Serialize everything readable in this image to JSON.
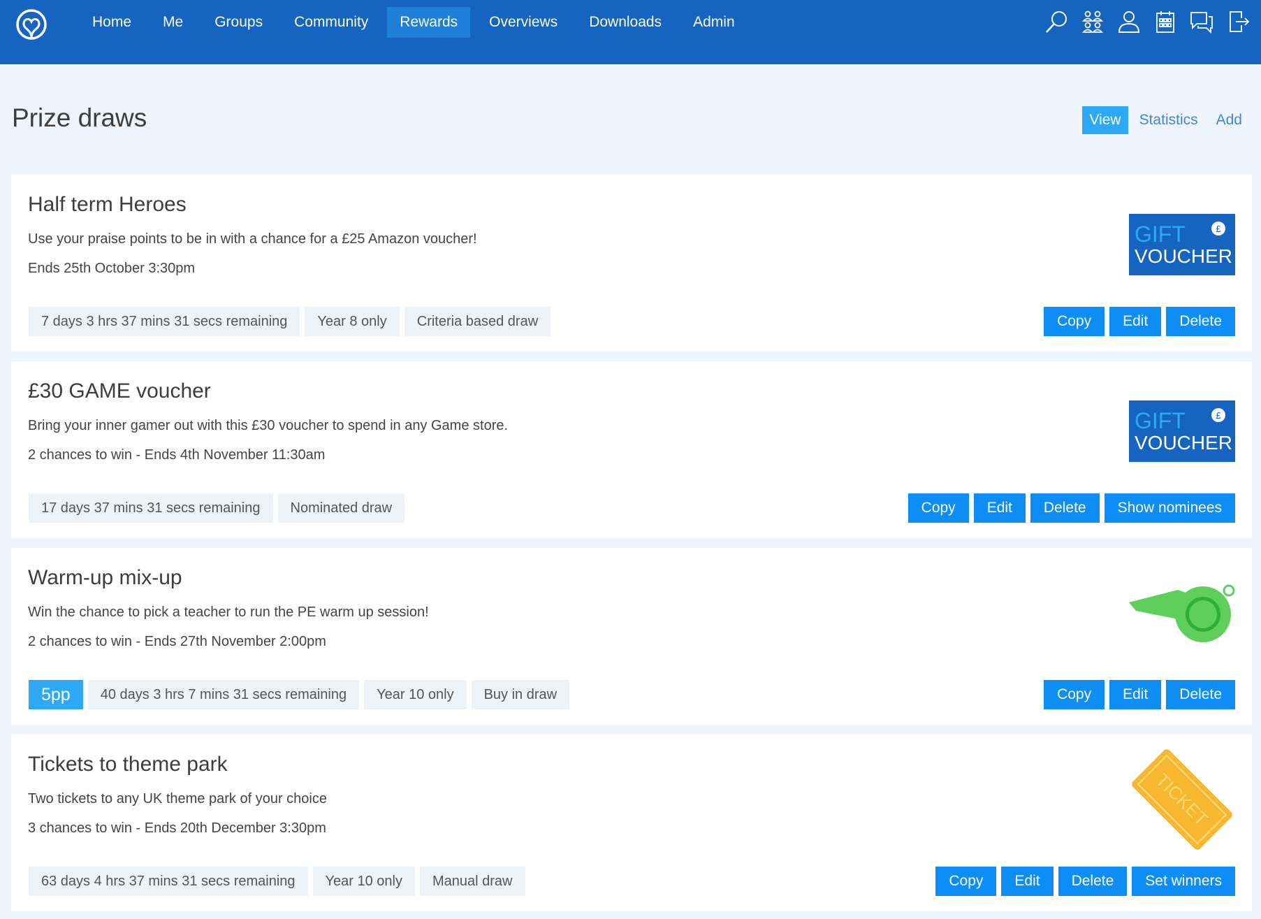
{
  "nav": {
    "logo_icon": "brand-swirl-logo",
    "items": [
      "Home",
      "Me",
      "Groups",
      "Community",
      "Rewards",
      "Overviews",
      "Downloads",
      "Admin"
    ],
    "active_index": 4,
    "icons": [
      "search-icon",
      "groups-icon",
      "user-icon",
      "calendar-icon",
      "messages-icon",
      "logout-icon"
    ]
  },
  "page": {
    "title": "Prize draws",
    "tabs": [
      "View",
      "Statistics",
      "Add"
    ],
    "active_tab": 0
  },
  "draws": [
    {
      "title": "Half term Heroes",
      "description": "Use your praise points to be in with a chance for a £25 Amazon voucher!",
      "meta": "Ends 25th October 3:30pm",
      "price": null,
      "tags": [
        "7 days 3 hrs 37 mins 31 secs remaining",
        "Year 8 only",
        "Criteria based draw"
      ],
      "actions": [
        "Copy",
        "Edit",
        "Delete"
      ],
      "image": "gift-voucher",
      "image_text": [
        "GIFT",
        "VOUCHER",
        "£"
      ]
    },
    {
      "title": "£30 GAME voucher",
      "description": "Bring your inner gamer out with this £30 voucher to spend in any Game store.",
      "meta": "2 chances to win - Ends 4th November 11:30am",
      "price": null,
      "tags": [
        "17 days 37 mins 31 secs remaining",
        "Nominated draw"
      ],
      "actions": [
        "Copy",
        "Edit",
        "Delete",
        "Show nominees"
      ],
      "image": "gift-voucher",
      "image_text": [
        "GIFT",
        "VOUCHER",
        "£"
      ]
    },
    {
      "title": "Warm-up mix-up",
      "description": "Win the chance to pick a teacher to run the PE warm up session!",
      "meta": "2 chances to win - Ends 27th November 2:00pm",
      "price": "5pp",
      "tags": [
        "40 days 3 hrs 7 mins 31 secs remaining",
        "Year 10 only",
        "Buy in draw"
      ],
      "actions": [
        "Copy",
        "Edit",
        "Delete"
      ],
      "image": "whistle",
      "image_text": []
    },
    {
      "title": "Tickets to theme park",
      "description": "Two tickets to any UK theme park of your choice",
      "meta": "3 chances to win - Ends 20th December 3:30pm",
      "price": null,
      "tags": [
        "63 days 4 hrs 37 mins 31 secs remaining",
        "Year 10 only",
        "Manual draw"
      ],
      "actions": [
        "Copy",
        "Edit",
        "Delete",
        "Set winners"
      ],
      "image": "ticket",
      "image_text": [
        "TICKET"
      ]
    }
  ],
  "colors": {
    "nav_bar": "#1565c0",
    "nav_active": "#1e80d8",
    "page_bg": "#eef5fd",
    "button": "#0d8ef7",
    "price_tag": "#2ca8f5",
    "voucher": "#1565c0",
    "whistle": "#5ecf5a",
    "ticket": "#f8b731"
  }
}
